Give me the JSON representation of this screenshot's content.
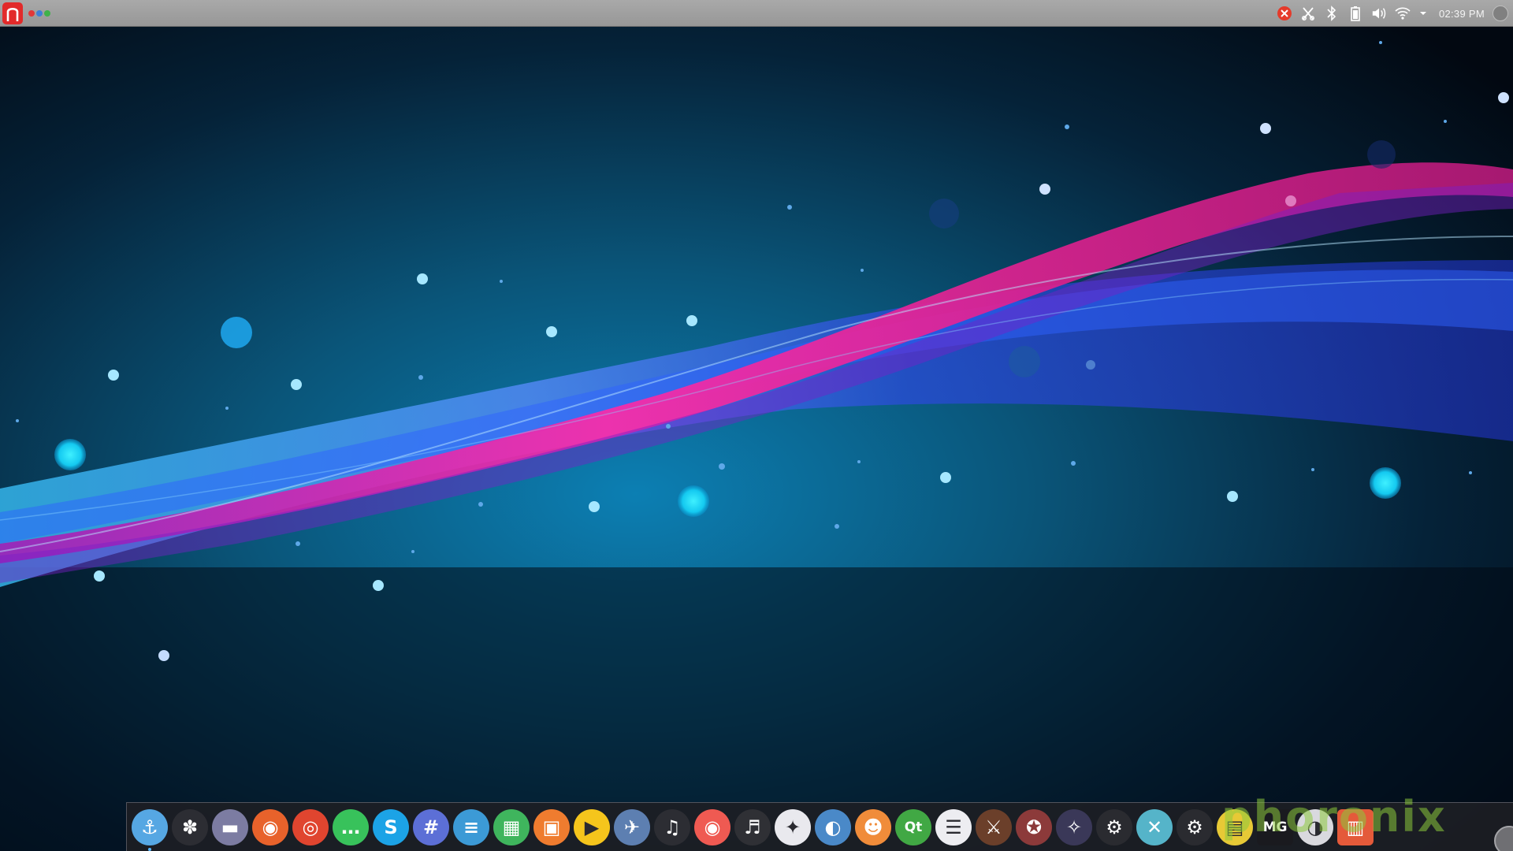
{
  "top_panel": {
    "menu_icon": "red-arch-launcher-icon",
    "tray_icons": [
      "red-shield-update-icon",
      "scissors-icon",
      "bluetooth-icon",
      "battery-icon",
      "volume-icon",
      "wifi-icon",
      "chevron-down-icon"
    ],
    "clock": "02:39 PM"
  },
  "dock": {
    "items": [
      {
        "name": "anchor",
        "glyph": "⚓",
        "bg": "#56a7e3",
        "running": true
      },
      {
        "name": "flower-system",
        "glyph": "✽",
        "bg": "#2c2d33"
      },
      {
        "name": "files",
        "glyph": "▬",
        "bg": "#7c7ca2"
      },
      {
        "name": "firefox",
        "glyph": "◉",
        "bg": "#e8622b"
      },
      {
        "name": "chrome",
        "glyph": "◎",
        "bg": "#e0452f"
      },
      {
        "name": "messaging",
        "glyph": "…",
        "bg": "#38c25b"
      },
      {
        "name": "skype",
        "glyph": "S",
        "bg": "#1ca3e6"
      },
      {
        "name": "hashtag-chat",
        "glyph": "#",
        "bg": "#5c6fd6"
      },
      {
        "name": "document-writer",
        "glyph": "≡",
        "bg": "#3c9ad6"
      },
      {
        "name": "spreadsheet",
        "glyph": "▦",
        "bg": "#3fb55d"
      },
      {
        "name": "presentation",
        "glyph": "▣",
        "bg": "#ef7c2f"
      },
      {
        "name": "media-player",
        "glyph": "▶",
        "bg": "#f5c51c"
      },
      {
        "name": "plane-app",
        "glyph": "✈",
        "bg": "#5d7fb1"
      },
      {
        "name": "music-note",
        "glyph": "♫",
        "bg": "#2c2d33"
      },
      {
        "name": "record",
        "glyph": "◉",
        "bg": "#ef5a52"
      },
      {
        "name": "headphones",
        "glyph": "♬",
        "bg": "#2f3035"
      },
      {
        "name": "satellite",
        "glyph": "✦",
        "bg": "#e9e9ee"
      },
      {
        "name": "blender",
        "glyph": "◐",
        "bg": "#4a89c8"
      },
      {
        "name": "gimp",
        "glyph": "☻",
        "bg": "#f08c3a"
      },
      {
        "name": "qt-creator",
        "glyph": "Qt",
        "bg": "#41a844"
      },
      {
        "name": "eclipse",
        "glyph": "☰",
        "bg": "#ededf1"
      },
      {
        "name": "game-warrior",
        "glyph": "⚔",
        "bg": "#6b3f2a"
      },
      {
        "name": "game-hero",
        "glyph": "✪",
        "bg": "#8c3a3a"
      },
      {
        "name": "game-champion",
        "glyph": "✧",
        "bg": "#3a3858"
      },
      {
        "name": "steam-1",
        "glyph": "⚙",
        "bg": "#2a2b30"
      },
      {
        "name": "crossed-app",
        "glyph": "✕",
        "bg": "#55b4c9"
      },
      {
        "name": "steam-2",
        "glyph": "⚙",
        "bg": "#2a2b30"
      },
      {
        "name": "retro-console",
        "glyph": "▤",
        "bg": "#e7c936"
      },
      {
        "name": "emulator-mg",
        "glyph": "MG",
        "bg": "#1a1a1f"
      },
      {
        "name": "toggle-app",
        "glyph": "◑",
        "bg": "#d9d9de"
      },
      {
        "name": "trash",
        "glyph": "▥",
        "bg": "#e45a3a"
      }
    ]
  },
  "watermark": "phoronix",
  "colors": {
    "panel": "#a0a0a0",
    "dock": "#1c1e24",
    "accent": "#58b7ff"
  }
}
